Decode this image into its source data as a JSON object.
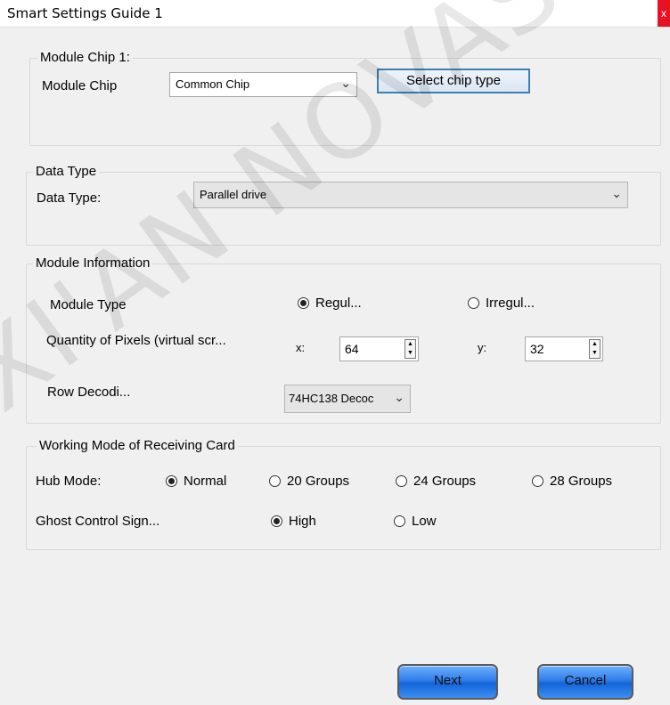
{
  "window": {
    "title": "Smart Settings Guide 1",
    "close_label": "x"
  },
  "watermark": "XI'AN NOVASTAR TECH",
  "module_chip": {
    "legend": "Module Chip 1:",
    "label": "Module Chip",
    "selected": "Common Chip",
    "button": "Select chip type"
  },
  "data_type": {
    "legend": "Data Type",
    "label": "Data Type:",
    "selected": "Parallel drive"
  },
  "module_info": {
    "legend": "Module Information",
    "module_type_label": "Module Type",
    "options": [
      "Regul...",
      "Irregul..."
    ],
    "selected_option": "Regul...",
    "pixels_label": "Quantity of Pixels (virtual scr...",
    "x_label": "x:",
    "x_value": "64",
    "y_label": "y:",
    "y_value": "32",
    "row_decoding_label": "Row Decodi...",
    "row_decoding_value": "74HC138 Decoc"
  },
  "working_mode": {
    "legend": "Working Mode of Receiving Card",
    "hub_label": "Hub Mode:",
    "hub_options": [
      "Normal",
      "20 Groups",
      "24 Groups",
      "28 Groups"
    ],
    "hub_selected": "Normal",
    "ghost_label": "Ghost Control Sign...",
    "ghost_options": [
      "High",
      "Low"
    ],
    "ghost_selected": "High"
  },
  "footer": {
    "next": "Next",
    "cancel": "Cancel"
  }
}
